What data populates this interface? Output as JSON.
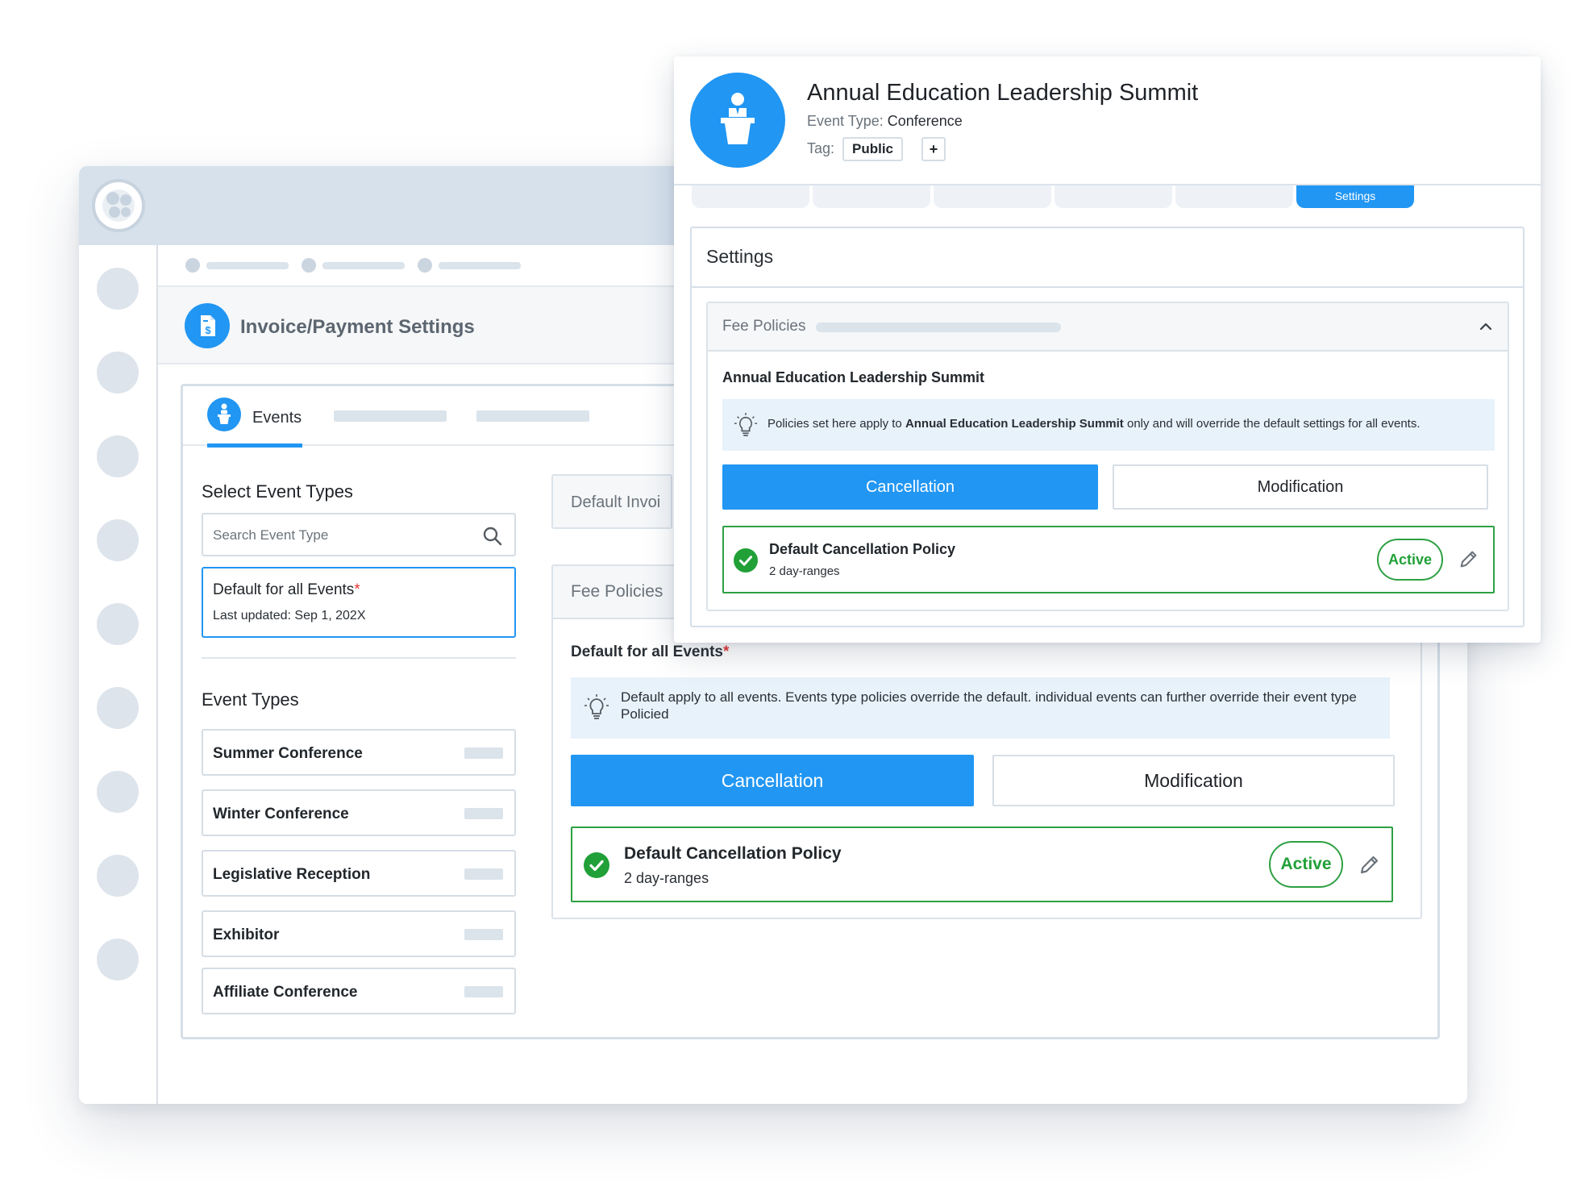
{
  "colors": {
    "accent": "#2196f3",
    "success": "#21a038",
    "required": "#e53935",
    "info_bg": "#e8f2fb"
  },
  "back_window": {
    "page_title": "Invoice/Payment Settings",
    "page_icon": "invoice-dollar-icon",
    "tabs": [
      {
        "label": "Events",
        "icon": "podium-speaker-icon",
        "active": true
      }
    ],
    "select_event_types": {
      "heading": "Select Event Types",
      "search_placeholder": "Search Event Type",
      "default_item": {
        "title": "Default for all Events",
        "required_mark": "*",
        "updated": "Last updated: Sep 1, 202X"
      }
    },
    "event_types": {
      "heading": "Event Types",
      "items": [
        "Summer Conference",
        "Winter Conference",
        "Legislative Reception",
        "Exhibitor",
        "Affiliate Conference"
      ]
    },
    "default_invoice_panel": {
      "label": "Default Invoi"
    },
    "fee_policies": {
      "header": "Fee Policies",
      "subheading": "Default for all Events",
      "required_mark": "*",
      "info": "Default apply to all events. Events type policies override the default. individual events can further override their event type Policied",
      "buttons": {
        "cancellation": "Cancellation",
        "modification": "Modification"
      },
      "policy": {
        "title": "Default Cancellation Policy",
        "subtitle": "2 day-ranges",
        "status": "Active"
      }
    }
  },
  "modal": {
    "event_title": "Annual Education Leadership Summit",
    "event_type_label": "Event Type:",
    "event_type_value": "Conference",
    "tag_label": "Tag:",
    "tag_value": "Public",
    "tag_add": "+",
    "active_tab": "Settings",
    "settings_title": "Settings",
    "fee_policies": {
      "header": "Fee Policies",
      "subheading": "Annual Education Leadership Summit",
      "info_prefix": "Policies set here apply to ",
      "info_event": "Annual Education Leadership Summit",
      "info_suffix": " only and will override the default settings for all events.",
      "buttons": {
        "cancellation": "Cancellation",
        "modification": "Modification"
      },
      "policy": {
        "title": "Default Cancellation Policy",
        "subtitle": "2 day-ranges",
        "status": "Active"
      }
    }
  }
}
